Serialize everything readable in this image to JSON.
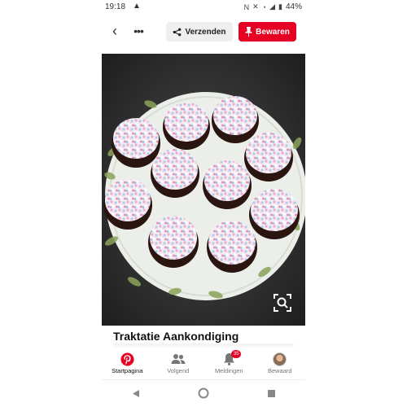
{
  "status_bar": {
    "time": "19:18",
    "battery": "44%"
  },
  "action_bar": {
    "send_label": "Verzenden",
    "save_label": "Bewaren",
    "save_color": "#e60023"
  },
  "pin": {
    "title": "Traktatie Aankondiging"
  },
  "bottom_nav": {
    "items": [
      {
        "label": "Startpagina",
        "icon": "pinterest-logo-icon",
        "active": true
      },
      {
        "label": "Volgend",
        "icon": "people-icon"
      },
      {
        "label": "Meldingen",
        "icon": "bell-icon",
        "badge": "35"
      },
      {
        "label": "Bewaard",
        "icon": "avatar"
      }
    ]
  },
  "system_nav": [
    "back-triangle-icon",
    "home-circle-icon",
    "recents-square-icon"
  ]
}
